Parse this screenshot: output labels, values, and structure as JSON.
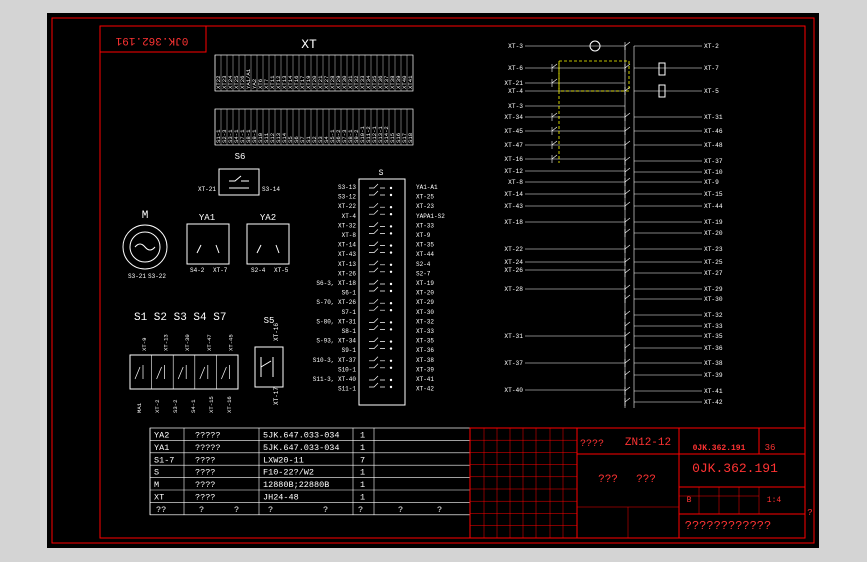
{
  "colors": {
    "background": "#000000",
    "line": "#ffffff",
    "frame": "#ff0000",
    "dashed": "#ffff00",
    "table_text": "#ffffff",
    "title_text": "#ff3333"
  },
  "drawing_number_mirrored": "0JK.362.191",
  "terminal_block": {
    "title": "XT",
    "top_row": [
      "XT22",
      "XT23",
      "XT24",
      "XT25",
      "XT26",
      "YA1/A1",
      "YA2",
      "XT6",
      "XT7",
      "XT11",
      "XT12",
      "XT13",
      "XT14",
      "XT16",
      "XT17",
      "XT19",
      "XT20",
      "XT21",
      "XT27",
      "XT28",
      "XT29",
      "XT30",
      "XT31",
      "XT32",
      "XT33",
      "XT34",
      "XT35",
      "XT36",
      "XT37",
      "XT38",
      "XT39",
      "XT40",
      "XT41"
    ],
    "bottom_row": [
      "S1-1",
      "S2-3",
      "S3-1",
      "S4-1",
      "S7-1",
      "S8-1",
      "S9-1",
      "S10",
      "S11",
      "S12",
      "S13",
      "S14",
      "S5",
      "S6",
      "S7",
      "S1",
      "S2",
      "S3",
      "S4",
      "S5-1",
      "S6-2",
      "S7-3",
      "S8-1",
      "S9-2",
      "S10-1",
      "S11-2",
      "S12-1",
      "S13-1",
      "S14-2",
      "S15",
      "S16",
      "S17",
      "S18"
    ]
  },
  "components": {
    "s6": {
      "label": "S6",
      "left": "XT-21",
      "right": "S3-14"
    },
    "motor": {
      "label": "M",
      "pins": [
        "S3-21",
        "S3-22"
      ]
    },
    "ya1": {
      "label": "YA1",
      "pins": [
        "S4-2",
        "XT-7"
      ]
    },
    "ya2": {
      "label": "YA2",
      "pins": [
        "S2-4",
        "XT-5"
      ]
    },
    "switches": {
      "label": "S1 S2 S3 S4  S7",
      "top": [
        "XT-9",
        "XT-13",
        "XT-30",
        "XT-47",
        "XT-45"
      ],
      "bottom": [
        "MA1",
        "XT-2",
        "S3-2",
        "S4-1",
        "XT-15",
        "XT-16"
      ]
    },
    "s5": {
      "label": "S5",
      "top": "XT-16",
      "bottom": "XT-17"
    },
    "s3": {
      "label": "S",
      "left": [
        "S3-13",
        "S3-12",
        "XT-22",
        "XT-4",
        "XT-32",
        "XT-8",
        "XT-14",
        "XT-43",
        "XT-13",
        "XT-26",
        "S6-3, XT-18",
        "S6-1",
        "S-70, XT-26",
        "S7-1",
        "S-80, XT-31",
        "S8-1",
        "S-93, XT-34",
        "S9-1",
        "S10-3, XT-37",
        "S10-1",
        "S11-3, XT-40",
        "S11-1"
      ],
      "right": [
        "YA1-A1",
        "XT-25",
        "XT-23",
        "YAPA1-S2",
        "XT-33",
        "XT-9",
        "XT-35",
        "XT-44",
        "S2-4",
        "S2-7",
        "XT-19",
        "XT-20",
        "XT-29",
        "XT-30",
        "XT-32",
        "XT-33",
        "XT-35",
        "XT-36",
        "XT-38",
        "XT-39",
        "XT-41",
        "XT-42"
      ]
    }
  },
  "schematic": {
    "left_labels": [
      "XT-3",
      "XT-6",
      "XT-21",
      "XT-4",
      "XT-3",
      "XT-34",
      "XT-45",
      "XT-47",
      "XT-16",
      "XT-12",
      "XT-8",
      "XT-14",
      "XT-43",
      "XT-18",
      "XT-22",
      "XT-24",
      "XT-26",
      "XT-28",
      "XT-31",
      "XT-37",
      "XT-40"
    ],
    "right_labels": [
      "XT-2",
      "XT-7",
      "XT-5",
      "XT-31",
      "XT-46",
      "XT-48",
      "XT-37",
      "XT-10",
      "XT-9",
      "XT-15",
      "XT-44",
      "XT-19",
      "XT-20",
      "XT-23",
      "XT-25",
      "XT-27",
      "XT-29",
      "XT-30",
      "XT-32",
      "XT-33",
      "XT-35",
      "XT-36",
      "XT-38",
      "XT-39",
      "XT-41",
      "XT-42"
    ]
  },
  "bom": {
    "rows": [
      {
        "code": "YA2",
        "name": "?????",
        "spec": "5JK.647.033-034",
        "qty": "1"
      },
      {
        "code": "YA1",
        "name": "?????",
        "spec": "5JK.647.033-034",
        "qty": "1"
      },
      {
        "code": "S1-7",
        "name": "????",
        "spec": "LXW20-11",
        "qty": "7"
      },
      {
        "code": "S",
        "name": "????",
        "spec": "F10-22?/W2",
        "qty": "1"
      },
      {
        "code": "M",
        "name": "????",
        "spec": "12880B;22880B",
        "qty": "1"
      },
      {
        "code": "XT",
        "name": "????",
        "spec": "JH24-48",
        "qty": "1"
      }
    ],
    "header": {
      "code": "??",
      "name": "?",
      "spec": "?",
      "qty": "?",
      "c1": "?",
      "c2": "?",
      "c3": "?",
      "c4": "?"
    }
  },
  "title_block": {
    "product_label": "????",
    "product_code": "ZN12-12",
    "drawing_name_left": "???",
    "drawing_name_right": "???",
    "drawing_number": "0JK.362.191",
    "drawing_number_top": "0JK.362.191",
    "sheet_count": "36",
    "stage": "B",
    "scale": "1:4",
    "company": "????????????",
    "corner_mark": "?"
  }
}
